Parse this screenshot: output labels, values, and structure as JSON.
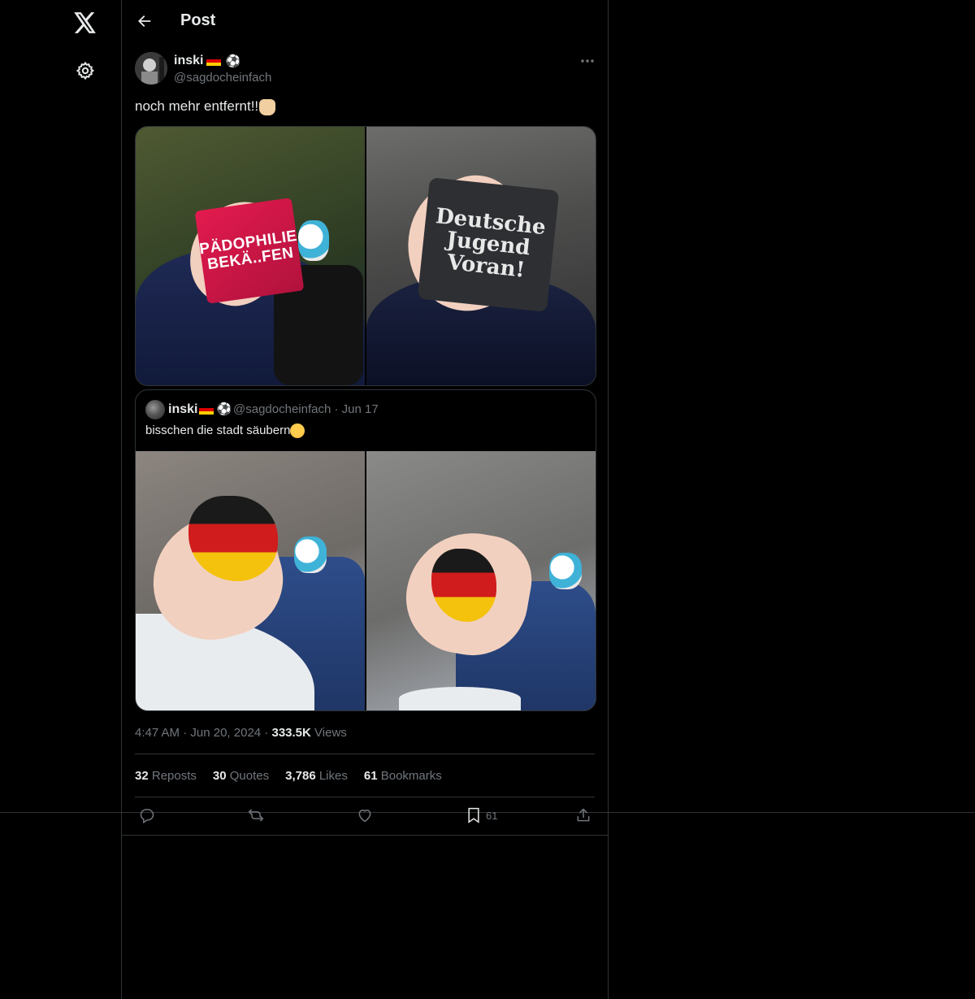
{
  "nav": {
    "logo_icon": "x-logo-icon",
    "settings_icon": "gear-icon"
  },
  "header": {
    "title": "Post",
    "back_icon": "arrow-left-icon"
  },
  "post": {
    "author_name": "inski",
    "author_handle": "@sagdocheinfach",
    "text": "noch mehr entfernt!!",
    "media": [
      {
        "printed_text": [
          "PÄDOPHILIE",
          "BEKÄ..FEN"
        ]
      },
      {
        "printed_text": [
          "Deutsche",
          "Jugend",
          "Voran!"
        ]
      }
    ],
    "time": "4:47 AM",
    "date": "Jun 20, 2024",
    "views_count": "333.5K",
    "views_label": "Views",
    "stats": {
      "reposts_count": "32",
      "reposts_label": "Reposts",
      "quotes_count": "30",
      "quotes_label": "Quotes",
      "likes_count": "3,786",
      "likes_label": "Likes",
      "bookmarks_count": "61",
      "bookmarks_label": "Bookmarks"
    },
    "actions": {
      "bookmark_count": "61"
    }
  },
  "quoted": {
    "author_name": "inski",
    "author_handle": "@sagdocheinfach",
    "date": "Jun 17",
    "text": "bisschen die stadt säubern"
  },
  "colors": {
    "background": "#000000",
    "text_primary": "#e7e9ea",
    "text_secondary": "#71767b",
    "border": "#2f3336"
  }
}
